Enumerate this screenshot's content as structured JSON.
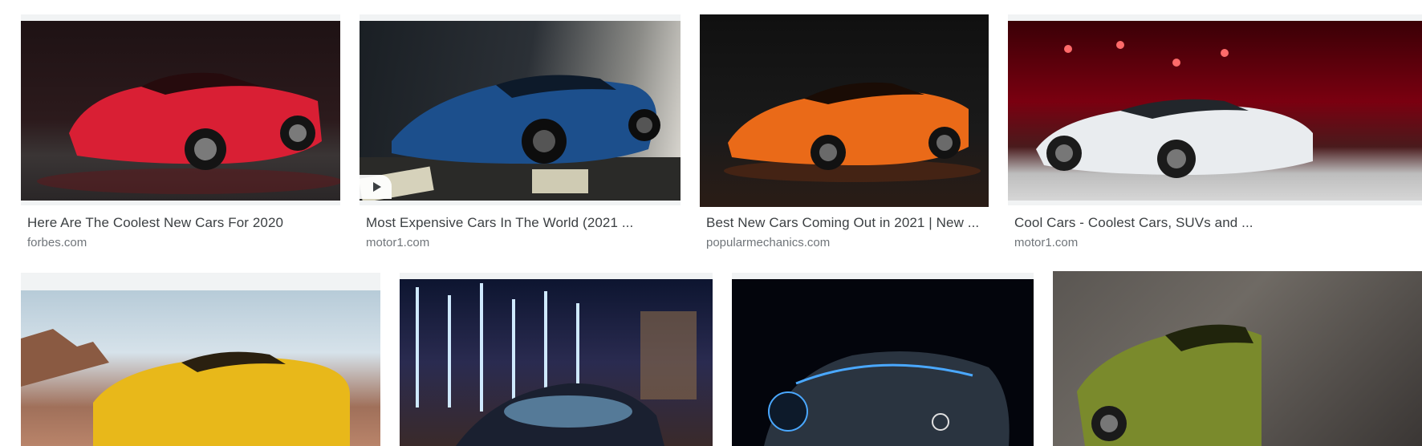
{
  "results": [
    {
      "title": "Here Are The Coolest New Cars For 2020",
      "source": "forbes.com",
      "car_color": "#d91f34",
      "has_video": false
    },
    {
      "title": "Most Expensive Cars In The World (2021 ...",
      "source": "motor1.com",
      "car_color": "#1c4f8c",
      "has_video": true
    },
    {
      "title": "Best New Cars Coming Out in 2021 | New ...",
      "source": "popularmechanics.com",
      "car_color": "#ea6a18",
      "has_video": false
    },
    {
      "title": "Cool Cars - Coolest Cars, SUVs and ...",
      "source": "motor1.com",
      "car_color": "#e9ecef",
      "has_video": false
    },
    {
      "title": "",
      "source": "",
      "car_color": "#e8b81a",
      "has_video": false
    },
    {
      "title": "",
      "source": "",
      "car_color": "#8fd3ff",
      "has_video": false
    },
    {
      "title": "",
      "source": "",
      "car_color": "#2a3440",
      "has_video": false
    },
    {
      "title": "",
      "source": "",
      "car_color": "#7a8a2c",
      "has_video": false
    }
  ],
  "icons": {
    "play": "play-icon"
  }
}
